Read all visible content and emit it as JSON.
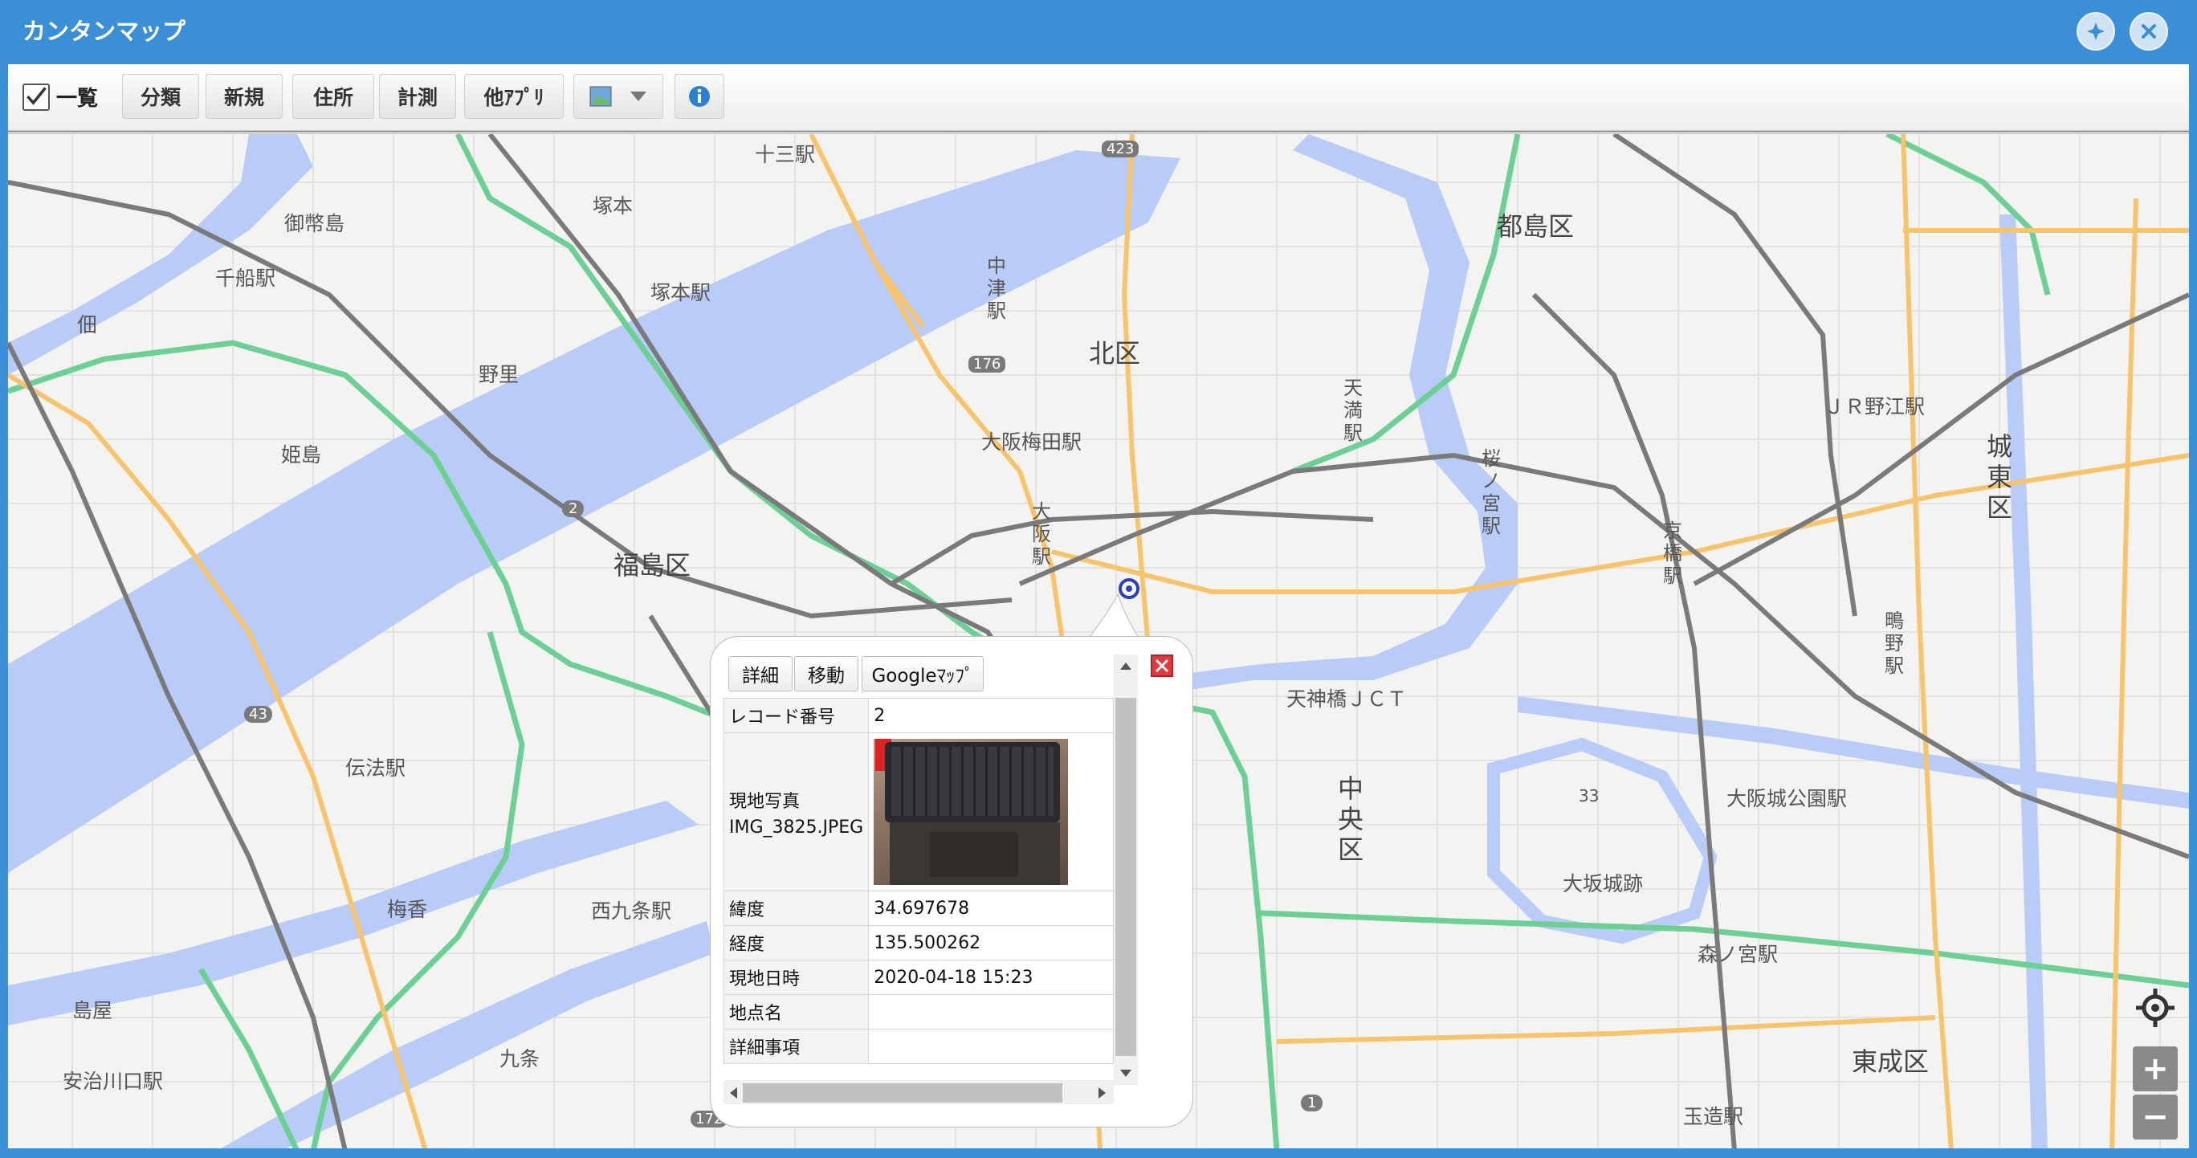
{
  "window": {
    "title": "カンタンマップ"
  },
  "toolbar": {
    "list_label": "一覧",
    "list_checked": true,
    "buttons": [
      "分類",
      "新規",
      "住所",
      "計測",
      "他ｱﾌﾟﾘ"
    ]
  },
  "map_labels": {
    "juso_eki": "十三駅",
    "tsukamoto": "塚本",
    "tsukamoto_eki": "塚本駅",
    "mitejima": "御幣島",
    "senbuna_eki": "千船駅",
    "tsukuda": "佃",
    "noda": "野里",
    "himejima": "姫島",
    "fukushima_ku": "福島区",
    "kita_ku": "北区",
    "nakatsu_eki": "中津駅",
    "osaka_umeda_eki": "大阪梅田駅",
    "osaka_eki": "大阪駅",
    "tenma_eki": "天満駅",
    "sakuranomiya_eki": "桜ノ宮駅",
    "miyakojima_ku": "都島区",
    "jr_noe_eki": "ＪＲ野江駅",
    "joto_ku": "城東区",
    "kyobashi_eki": "京橋駅",
    "shigino_eki": "鴫野駅",
    "tenjinbashi_jct": "天神橋ＪＣＴ",
    "chuo_ku": "中央区",
    "osakajo_koen_eki": "大阪城公園駅",
    "osakajo_ato": "大坂城跡",
    "denpo_eki": "伝法駅",
    "baika": "梅香",
    "nishikujo_eki": "西九条駅",
    "shimaya": "島屋",
    "kujo": "九条",
    "ajikawaguchi_eki": "安治川口駅",
    "morinomiya_eki": "森ノ宮駅",
    "higashinari_ku": "東成区",
    "tamatsukuri_eki": "玉造駅",
    "elev_33": "33",
    "route_423": "423",
    "route_176": "176",
    "route_2": "2",
    "route_43": "43",
    "route_1": "1",
    "route_172": "172"
  },
  "popup": {
    "buttons": [
      "詳細",
      "移動",
      "Googleﾏｯﾌﾟ"
    ],
    "rows": [
      {
        "key": "レコード番号",
        "value": "2"
      },
      {
        "key": "現地写真",
        "sub": "IMG_3825.JPEG",
        "value": ""
      },
      {
        "key": "緯度",
        "value": "34.697678"
      },
      {
        "key": "経度",
        "value": "135.500262"
      },
      {
        "key": "現地日時",
        "value": "2020-04-18 15:23"
      },
      {
        "key": "地点名",
        "value": ""
      },
      {
        "key": "詳細事項",
        "value": ""
      }
    ]
  },
  "zoom": {
    "plus": "+",
    "minus": "−"
  },
  "colors": {
    "titlebar": "#3a8fd6",
    "water": "#b9ccf7",
    "expressway": "#6ccf93",
    "road": "#f7c46c",
    "rail": "#777777"
  }
}
